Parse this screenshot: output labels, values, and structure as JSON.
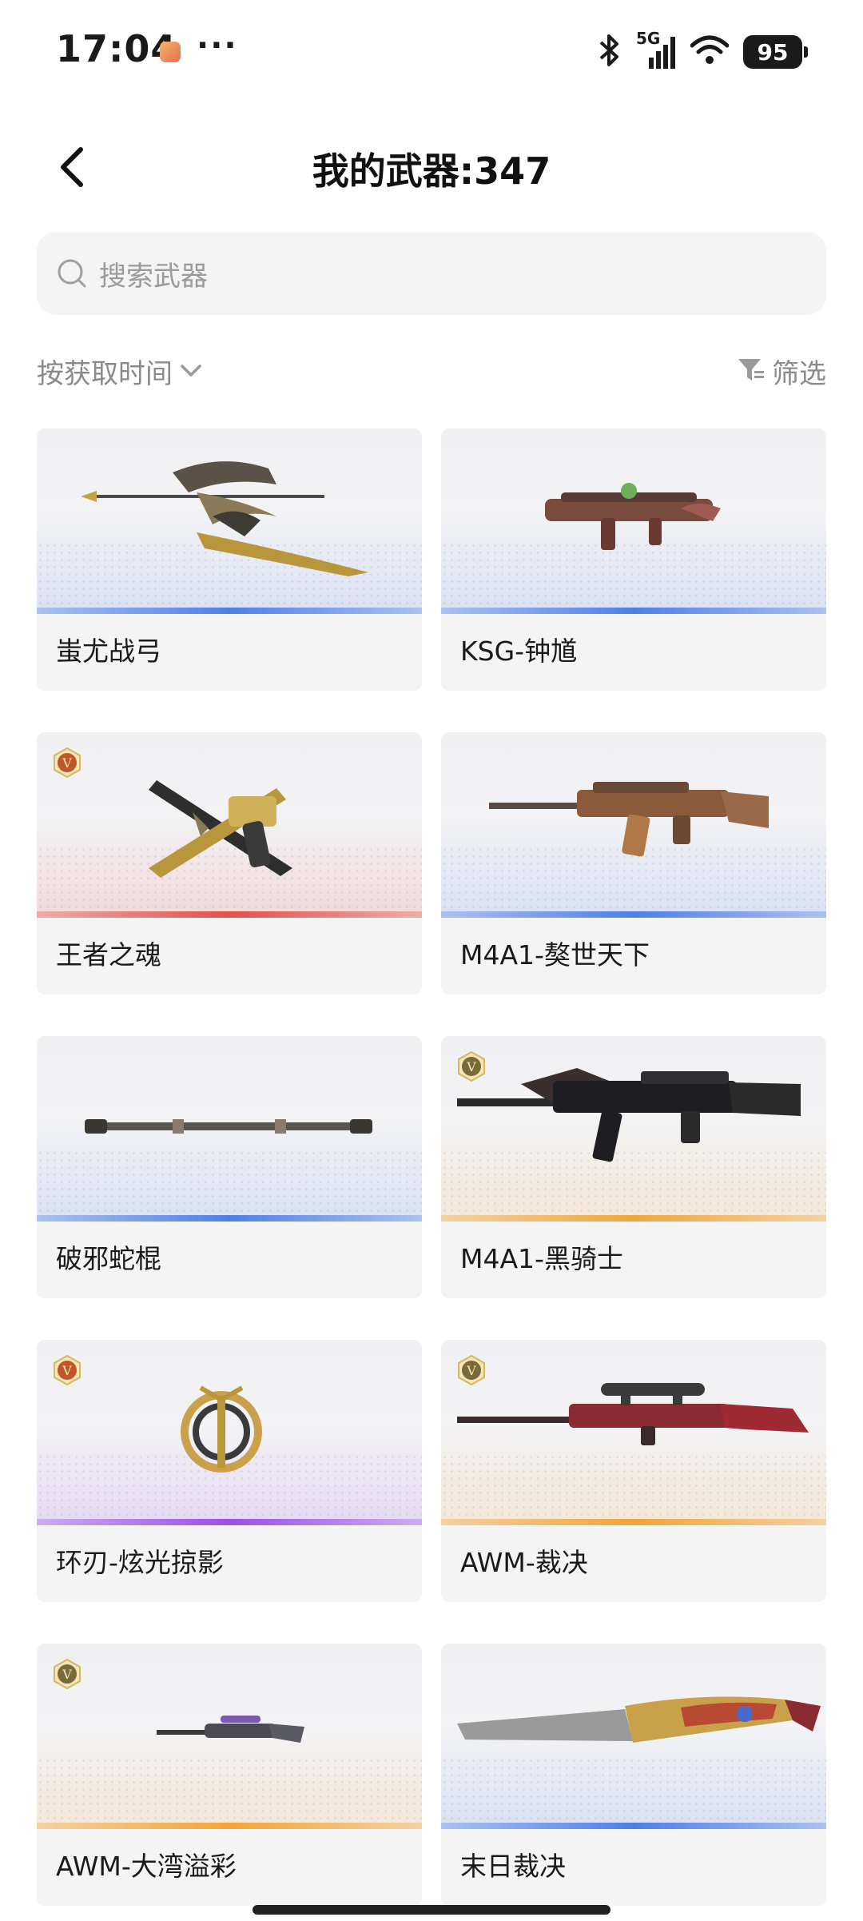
{
  "status_bar": {
    "time": "17:04",
    "more": "···",
    "network": "5G",
    "battery": "95"
  },
  "header": {
    "title": "我的武器:347"
  },
  "search": {
    "placeholder": "搜索武器"
  },
  "sort": {
    "label": "按获取时间"
  },
  "filter": {
    "label": "筛选"
  },
  "weapons": [
    {
      "name": "蚩尤战弓",
      "rarity_color": "#4f7fe6",
      "badge": ""
    },
    {
      "name": "KSG-钟馗",
      "rarity_color": "#4f7fe6",
      "badge": ""
    },
    {
      "name": "王者之魂",
      "rarity_color": "#e2504a",
      "badge": "V"
    },
    {
      "name": "M4A1-獒世天下",
      "rarity_color": "#4f7fe6",
      "badge": ""
    },
    {
      "name": "破邪蛇棍",
      "rarity_color": "#4f7fe6",
      "badge": ""
    },
    {
      "name": "M4A1-黑骑士",
      "rarity_color": "#f0a53a",
      "badge": "V"
    },
    {
      "name": "环刃-炫光掠影",
      "rarity_color": "#9b4fe6",
      "badge": "V"
    },
    {
      "name": "AWM-裁决",
      "rarity_color": "#f0a53a",
      "badge": "V"
    },
    {
      "name": "AWM-大湾溢彩",
      "rarity_color": "#f0a53a",
      "badge": "V"
    },
    {
      "name": "末日裁决",
      "rarity_color": "#4f7fe6",
      "badge": ""
    }
  ]
}
